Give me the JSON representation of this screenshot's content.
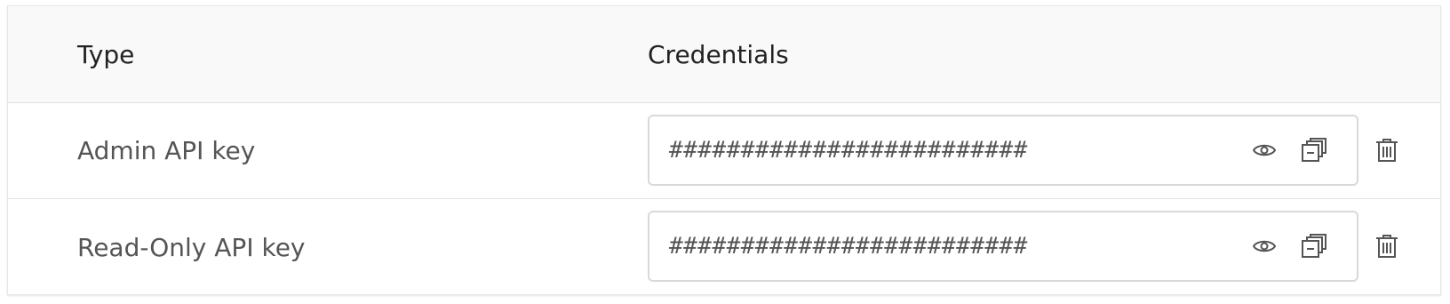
{
  "table": {
    "headers": {
      "type": "Type",
      "credentials": "Credentials"
    },
    "rows": [
      {
        "type": "Admin API key",
        "credential": "#########################",
        "icons": [
          "eye-icon",
          "copy-icon",
          "trash-icon"
        ]
      },
      {
        "type": "Read-Only API key",
        "credential": "#########################",
        "icons": [
          "eye-icon",
          "copy-icon",
          "trash-icon"
        ]
      }
    ]
  },
  "colors": {
    "header_bg": "#f9f9f9",
    "text": "#555555",
    "border": "#d8d8d8",
    "icon": "#555555"
  }
}
